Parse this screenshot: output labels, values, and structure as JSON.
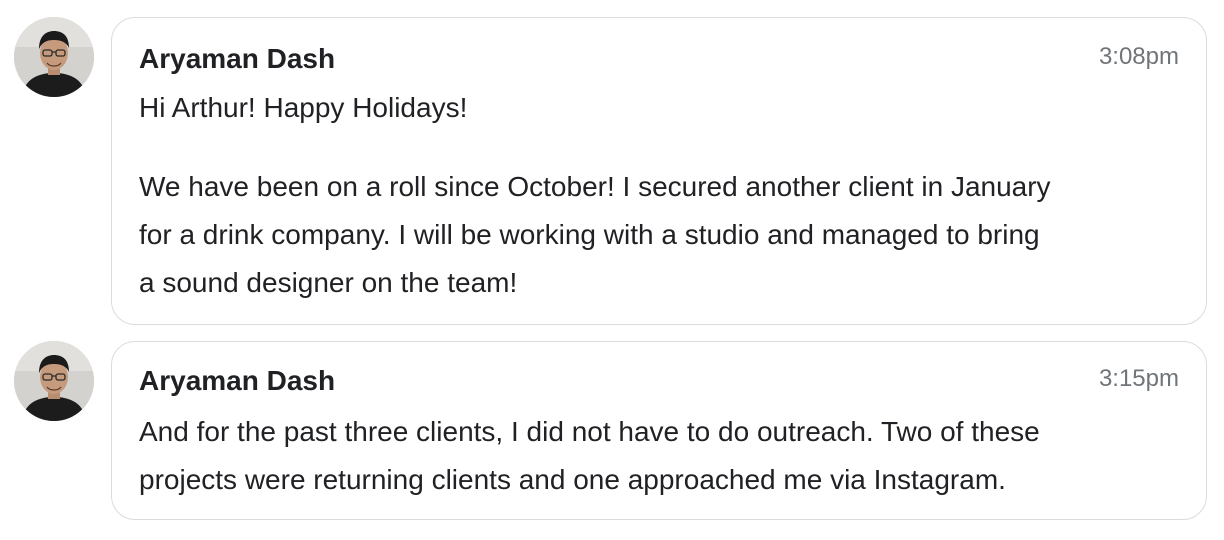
{
  "messages": [
    {
      "sender": "Aryaman Dash",
      "timestamp": "3:08pm",
      "avatar": "sender-avatar",
      "paragraphs": [
        [
          "Hi Arthur! Happy Holidays!"
        ],
        [
          "We have been on a roll since October! I secured another client in January",
          "for a drink company. I will be working with a studio and managed to bring",
          "a sound designer on the team!"
        ]
      ]
    },
    {
      "sender": "Aryaman Dash",
      "timestamp": "3:15pm",
      "avatar": "sender-avatar",
      "paragraphs": [
        [
          "And for the past three clients, I did not have to do outreach. Two of these",
          "projects were returning clients and one approached me via Instagram."
        ]
      ]
    }
  ],
  "colors": {
    "bubble_border": "#dadce0",
    "text": "#202124",
    "timestamp": "#70757a"
  }
}
